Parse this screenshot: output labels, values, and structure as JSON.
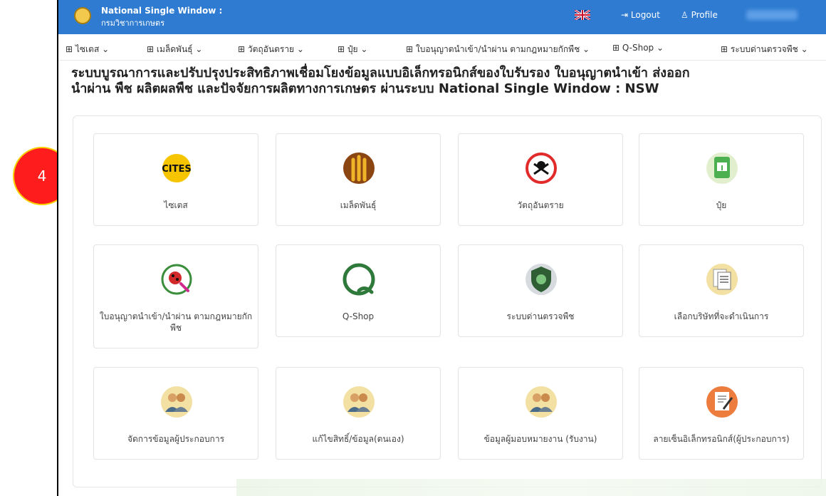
{
  "header": {
    "brand_line1": "National Single Window :",
    "brand_line2": "กรมวิชาการเกษตร",
    "logout": "Logout",
    "profile": "Profile"
  },
  "menu": [
    {
      "label": "ไซเตส"
    },
    {
      "label": "เมล็ดพันธุ์"
    },
    {
      "label": "วัตถุอันตราย"
    },
    {
      "label": "ปุ๋ย"
    },
    {
      "label": "ใบอนุญาตนำเข้า/นำผ่าน ตามกฎหมายกักพืช"
    },
    {
      "label": "Q-Shop"
    },
    {
      "label": "ระบบด่านตรวจพืช"
    }
  ],
  "page": {
    "title_line1": "ระบบบูรณาการและปรับปรุงประสิทธิภาพเชื่อมโยงข้อมูลแบบอิเล็กทรอนิกส์ของใบรับรอง ใบอนุญาตนำเข้า ส่งออก",
    "title_line2": "นำผ่าน พืช ผลิตผลพืช และปัจจัยการผลิตทางการเกษตร ผ่านระบบ National Single Window : NSW"
  },
  "cards": [
    {
      "label": "ไซเตส",
      "icon": "cites-icon"
    },
    {
      "label": "เมล็ดพันธุ์",
      "icon": "seed-icon"
    },
    {
      "label": "วัตถุอันตราย",
      "icon": "hazard-icon"
    },
    {
      "label": "ปุ๋ย",
      "icon": "fertilizer-icon"
    },
    {
      "label": "ใบอนุญาตนำเข้า/นำผ่าน ตามกฎหมายกักพืช",
      "icon": "plant-quarantine-icon"
    },
    {
      "label": "Q-Shop",
      "icon": "qshop-icon"
    },
    {
      "label": "ระบบด่านตรวจพืช",
      "icon": "checkpoint-shield-icon"
    },
    {
      "label": "เลือกบริษัทที่จะดำเนินการ",
      "icon": "documents-icon"
    },
    {
      "label": "จัดการข้อมูลผู้ประกอบการ",
      "icon": "users-icon"
    },
    {
      "label": "แก้ไขสิทธิ์/ข้อมูล(ตนเอง)",
      "icon": "users-icon"
    },
    {
      "label": "ข้อมูลผู้มอบหมายงาน (รับงาน)",
      "icon": "users-icon"
    },
    {
      "label": "ลายเซ็นอิเล็กทรอนิกส์(ผู้ประกอบการ)",
      "icon": "signature-icon"
    }
  ],
  "badge": "4",
  "colors": {
    "header_bg": "#2e7bd1",
    "badge": "#ff1c1c"
  }
}
